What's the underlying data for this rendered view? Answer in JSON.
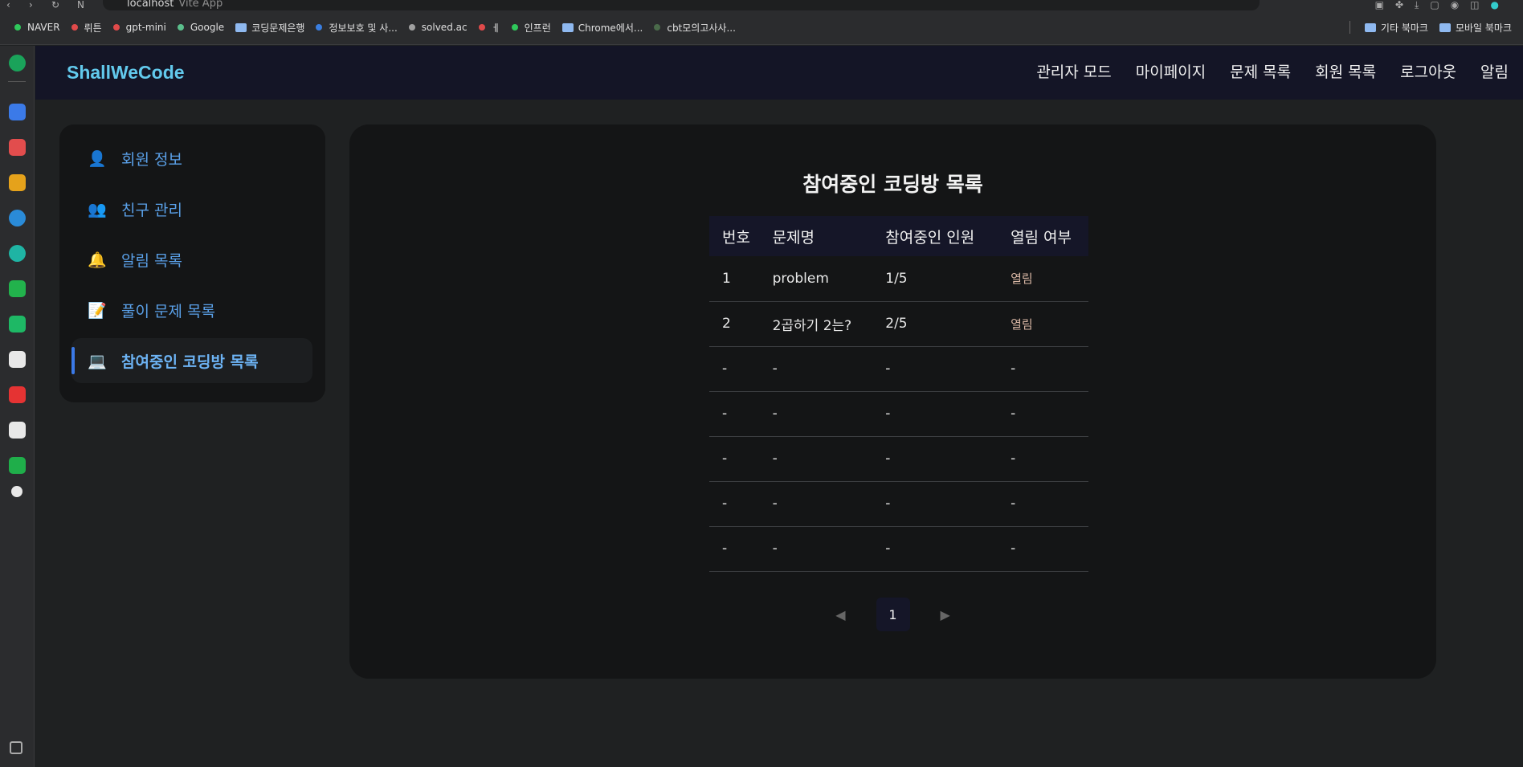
{
  "browser": {
    "url_host": "localhost",
    "tab_title": "Vite App",
    "bookmarks": [
      {
        "label": "NAVER",
        "color": "#2fc85b",
        "type": "dot"
      },
      {
        "label": "뤼튼",
        "color": "#e04a4a",
        "type": "dot"
      },
      {
        "label": "gpt-mini",
        "color": "#e04a4a",
        "type": "dot"
      },
      {
        "label": "Google",
        "color": "#5bbf8c",
        "type": "dot"
      },
      {
        "label": "코딩문제은행",
        "color": "#8fb9f0",
        "type": "folder"
      },
      {
        "label": "정보보호 및 사...",
        "color": "#3a7ee0",
        "type": "dot"
      },
      {
        "label": "solved.ac",
        "color": "#a0a0a0",
        "type": "dot"
      },
      {
        "label": "ㅔ",
        "color": "#e04a4a",
        "type": "dot"
      },
      {
        "label": "인프런",
        "color": "#2fc85b",
        "type": "dot"
      },
      {
        "label": "Chrome에서...",
        "color": "#8fb9f0",
        "type": "folder"
      },
      {
        "label": "cbt모의고사사...",
        "color": "#4a6a4a",
        "type": "dot"
      }
    ],
    "bookmarks_right": [
      {
        "label": "기타 북마크"
      },
      {
        "label": "모바일 북마크"
      }
    ]
  },
  "app": {
    "logo": "ShallWeCode",
    "nav": [
      "관리자 모드",
      "마이페이지",
      "문제 목록",
      "회원 목록",
      "로그아웃",
      "알림"
    ]
  },
  "sidebar": {
    "items": [
      {
        "label": "회원 정보",
        "icon": "person-icon",
        "glyph": "👤",
        "active": false
      },
      {
        "label": "친구 관리",
        "icon": "people-icon",
        "glyph": "👥",
        "active": false
      },
      {
        "label": "알림 목록",
        "icon": "bell-icon",
        "glyph": "🔔",
        "active": false
      },
      {
        "label": "풀이 문제 목록",
        "icon": "memo-icon",
        "glyph": "📝",
        "active": false
      },
      {
        "label": "참여중인 코딩방 목록",
        "icon": "laptop-icon",
        "glyph": "💻",
        "active": true
      }
    ]
  },
  "main": {
    "title": "참여중인 코딩방 목록",
    "columns": [
      "번호",
      "문제명",
      "참여중인 인원",
      "열림 여부"
    ],
    "rows": [
      [
        "1",
        "problem",
        "1/5",
        "열림"
      ],
      [
        "2",
        "2곱하기 2는?",
        "2/5",
        "열림"
      ],
      [
        "-",
        "-",
        "-",
        "-"
      ],
      [
        "-",
        "-",
        "-",
        "-"
      ],
      [
        "-",
        "-",
        "-",
        "-"
      ],
      [
        "-",
        "-",
        "-",
        "-"
      ],
      [
        "-",
        "-",
        "-",
        "-"
      ]
    ],
    "pagination": {
      "prev": "◀",
      "current": "1",
      "next": "▶"
    }
  },
  "colors": {
    "accent": "#62c9ec",
    "menu_text": "#5aa0e8",
    "active_bar": "#3b7ae8",
    "header_bg": "#141526"
  }
}
